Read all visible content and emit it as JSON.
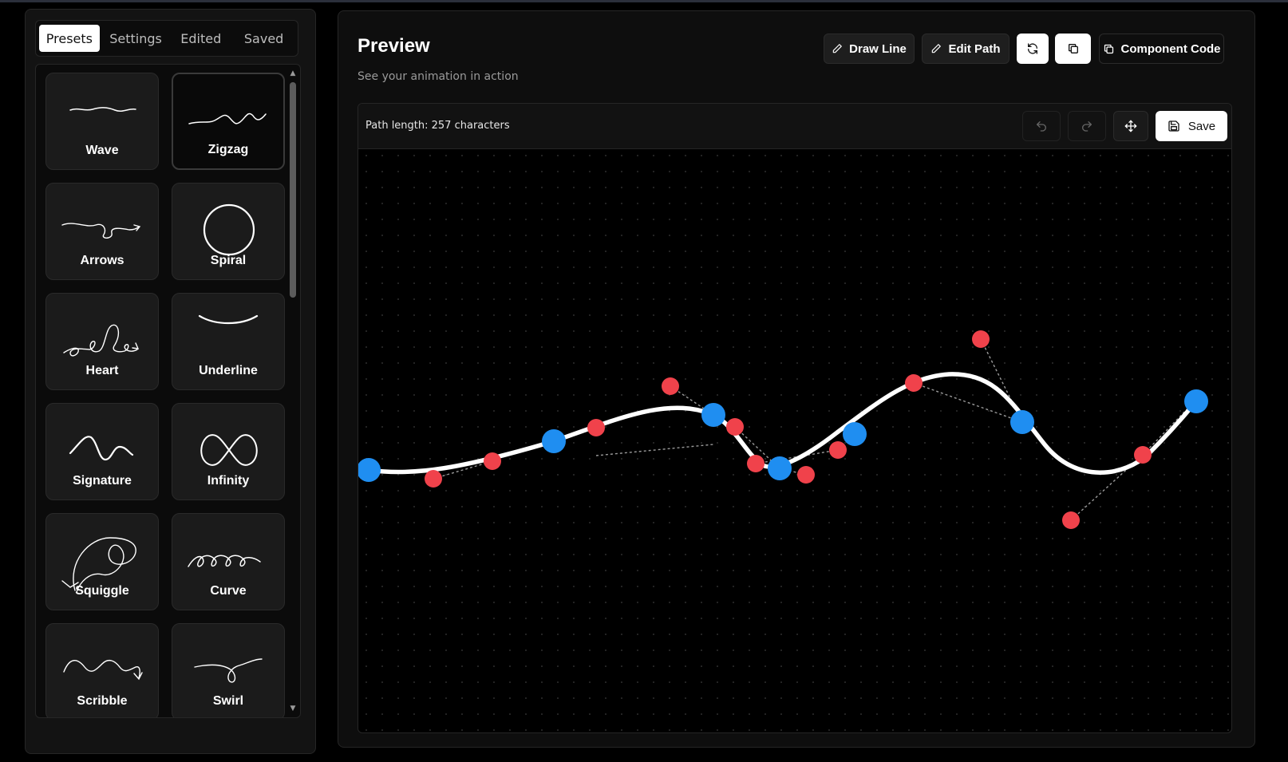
{
  "sidebar": {
    "tabs": [
      {
        "label": "Presets",
        "active": true
      },
      {
        "label": "Settings",
        "active": false
      },
      {
        "label": "Edited",
        "active": false
      },
      {
        "label": "Saved",
        "active": false
      }
    ],
    "presets": [
      {
        "name": "Wave",
        "icon": "wave-icon",
        "selected": false
      },
      {
        "name": "Zigzag",
        "icon": "zigzag-icon",
        "selected": true
      },
      {
        "name": "Arrows",
        "icon": "arrow-loop-icon",
        "selected": false
      },
      {
        "name": "Spiral",
        "icon": "circle-icon",
        "selected": false
      },
      {
        "name": "Heart",
        "icon": "loops-arrow-icon",
        "selected": false
      },
      {
        "name": "Underline",
        "icon": "underline-arc-icon",
        "selected": false
      },
      {
        "name": "Signature",
        "icon": "sine-wave-icon",
        "selected": false
      },
      {
        "name": "Infinity",
        "icon": "infinity-icon",
        "selected": false
      },
      {
        "name": "Squiggle",
        "icon": "squiggle-loop-icon",
        "selected": false
      },
      {
        "name": "Curve",
        "icon": "curly-loops-icon",
        "selected": false
      },
      {
        "name": "Scribble",
        "icon": "scribble-arrow-icon",
        "selected": false
      },
      {
        "name": "Swirl",
        "icon": "swirl-icon",
        "selected": false
      }
    ]
  },
  "preview": {
    "title": "Preview",
    "subtitle": "See your animation in action",
    "toolbar": {
      "draw_line": "Draw Line",
      "edit_path": "Edit Path",
      "refresh_icon": "refresh-icon",
      "copy_icon": "copy-icon",
      "component_code": "Component Code"
    },
    "editor": {
      "path_length": "Path length: 257 characters",
      "undo_icon": "undo-icon",
      "redo_icon": "redo-icon",
      "move_icon": "move-icon",
      "save_label": "Save"
    }
  },
  "colors": {
    "anchor": "#1f8ef1",
    "control": "#f0424b",
    "path": "#ffffff",
    "panel": "#131313",
    "background": "#000000"
  }
}
